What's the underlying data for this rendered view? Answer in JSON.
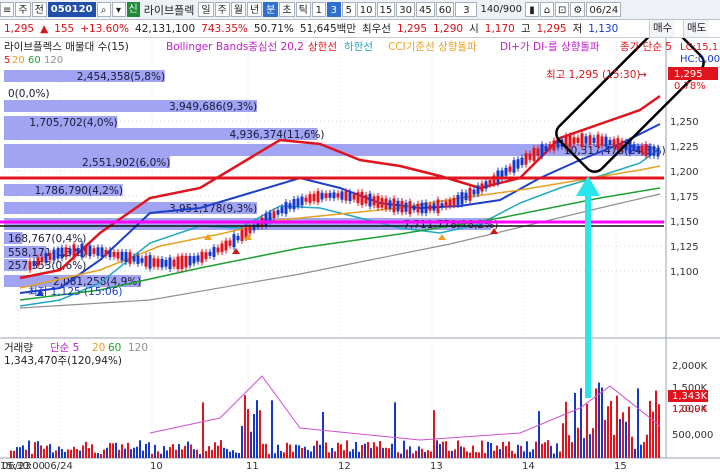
{
  "toolbar": {
    "menu_label": "주",
    "prev_label": "전",
    "code": "050120",
    "new_badge": "신",
    "stock_name": "라이브플렉",
    "periods": [
      "일",
      "주",
      "월",
      "년",
      "분",
      "초",
      "틱"
    ],
    "selected_period": "분",
    "intervals": [
      "1",
      "3",
      "5",
      "10",
      "15",
      "30",
      "45",
      "60"
    ],
    "selected_interval": "3",
    "interval_input": "3",
    "paging": "140/900",
    "date": "06/24"
  },
  "quote": {
    "price": "1,295",
    "arrow": "▲",
    "change": "155",
    "change_pct": "+13.60%",
    "volume": "42,131,100",
    "ratio1": "743.35%",
    "ratio2": "50.71%",
    "amount": "51,645백만",
    "best_bid_label": "최우선",
    "best_bid": "1,295",
    "best_ask": "1,290",
    "open_label": "시",
    "open": "1,170",
    "high_label": "고",
    "high": "1,295",
    "low_label": "저",
    "low": "1,130",
    "buy_label": "매수",
    "sell_label": "매도"
  },
  "price_panel": {
    "legend_title": "라이브플렉스 매물대 수(15)",
    "legend_bb": "Bollinger Bands중심선 20,2",
    "legend_upper": "상한선",
    "legend_lower": "하한선",
    "legend_cci": "CCI기준선 상향돌파",
    "legend_di": "DI+가 DI-를 상향돌파",
    "legend_ma": "종가 단순 5",
    "ma_periods": [
      "20",
      "60",
      "120"
    ],
    "ma_first": "5",
    "lc_label": "LC:15,1",
    "hc_label": "HC:0,00",
    "high_marker": "최고 1,295 (15:30)",
    "low_marker": "최저 1,125 (15:06)",
    "current_price_tag": "1,295",
    "change_tag": "0,78%",
    "volume_profile": [
      {
        "label": "2,454,358(5,8%)",
        "value": 2454358,
        "pct": 5.8
      },
      {
        "label": "0(0,0%)",
        "value": 0,
        "pct": 0.0
      },
      {
        "label": "3,949,686(9,3%)",
        "value": 3949686,
        "pct": 9.3
      },
      {
        "label": "1,705,702(4,0%)",
        "value": 1705702,
        "pct": 4.0
      },
      {
        "label": "4,936,374(11,6%)",
        "value": 4936374,
        "pct": 11.6
      },
      {
        "label": "10,317,478(24,3%)",
        "value": 10317478,
        "pct": 24.3
      },
      {
        "label": "2,551,902(6,0%)",
        "value": 2551902,
        "pct": 6.0
      },
      {
        "label": "1,786,790(4,2%)",
        "value": 1786790,
        "pct": 4.2
      },
      {
        "label": "3,951,178(9,3%)",
        "value": 3951178,
        "pct": 9.3
      },
      {
        "label": "7,711,778(18,2%)",
        "value": 7711778,
        "pct": 18.2
      },
      {
        "label": "168,767(0,4%)",
        "value": 168767,
        "pct": 0.4
      },
      {
        "label": "558,171(1,3%)",
        "value": 558171,
        "pct": 1.3
      },
      {
        "label": "257,353(0,6%)",
        "value": 257353,
        "pct": 0.6
      },
      {
        "label": "2,081,258(4,9%)",
        "value": 2081258,
        "pct": 4.9
      }
    ],
    "y_ticks": [
      "1,250",
      "1,225",
      "1,200",
      "1,175",
      "1,150",
      "1,125",
      "1,100"
    ]
  },
  "volume_panel": {
    "legend_title": "거래량",
    "legend_ma": "단순 5",
    "ma_periods": [
      "20",
      "60",
      "120"
    ],
    "value_label": "1,343,470주(120,94%)",
    "tag_volume": "1,343K",
    "tag_pct": "120,94",
    "y_ticks": [
      "2,000K",
      "1,500K",
      "1,000K",
      "500,000"
    ]
  },
  "x_axis": {
    "labels": [
      "06/23",
      "06/24",
      "10",
      "11",
      "12",
      "13",
      "14",
      "15",
      "15:30:00"
    ]
  },
  "colors": {
    "up": "#e0141e",
    "down": "#1438c8",
    "bb": "#e0141e",
    "profile": "#8f94f0",
    "hline_red": "#e0141e",
    "hline_magenta": "#ff00ff",
    "arrow": "#29e6ec"
  }
}
